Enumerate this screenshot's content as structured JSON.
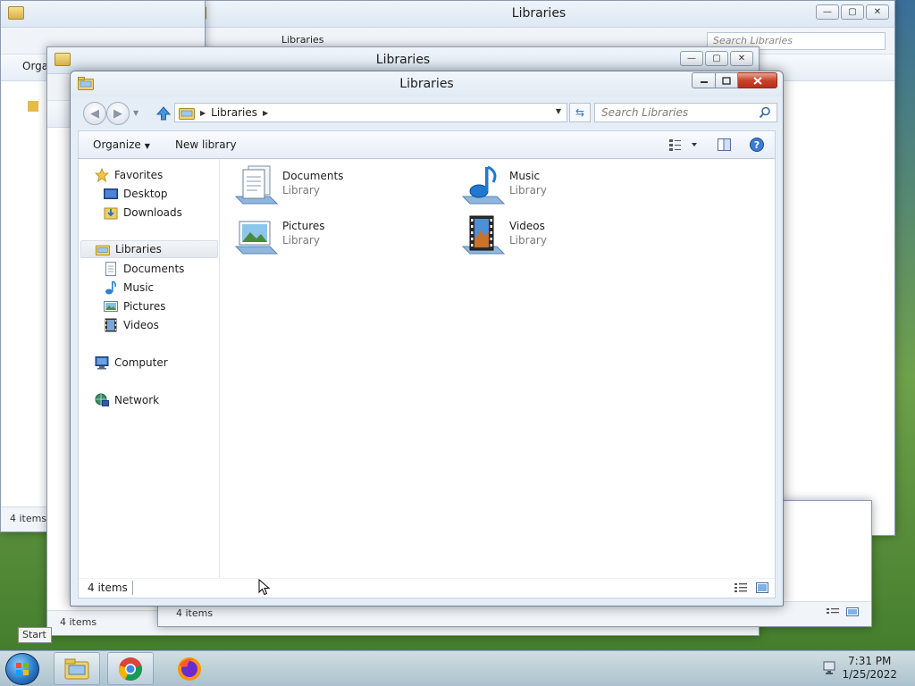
{
  "main_window": {
    "title": "Libraries",
    "address": {
      "crumb": "Libraries"
    },
    "search_placeholder": "Search Libraries",
    "toolbar": {
      "organize_label": "Organize",
      "new_library_label": "New library"
    },
    "nav": {
      "favorites": "Favorites",
      "desktop": "Desktop",
      "downloads": "Downloads",
      "libraries": "Libraries",
      "documents": "Documents",
      "music": "Music",
      "pictures": "Pictures",
      "videos": "Videos",
      "computer": "Computer",
      "network": "Network"
    },
    "files": [
      {
        "name": "Documents",
        "type": "Library",
        "icon": "documents-library-icon"
      },
      {
        "name": "Music",
        "type": "Library",
        "icon": "music-library-icon"
      },
      {
        "name": "Pictures",
        "type": "Library",
        "icon": "pictures-library-icon"
      },
      {
        "name": "Videos",
        "type": "Library",
        "icon": "videos-library-icon"
      }
    ],
    "status": {
      "count": "4 items"
    }
  },
  "background_windows": {
    "back_title": "Libraries",
    "back_crumb": "Libraries",
    "back_search": "Search Libraries",
    "mid_title": "Libraries",
    "mid_crumb": "Libraries",
    "status_count": "4 items",
    "organize_partial": "Orga"
  },
  "taskbar": {
    "start_tooltip": "Start",
    "clock_time": "7:31 PM",
    "clock_date": "1/25/2022",
    "apps": [
      "windows-explorer-icon",
      "chrome-icon",
      "firefox-icon"
    ]
  },
  "colors": {
    "accent": "#3a76c4",
    "close_button": "#c9432b"
  }
}
